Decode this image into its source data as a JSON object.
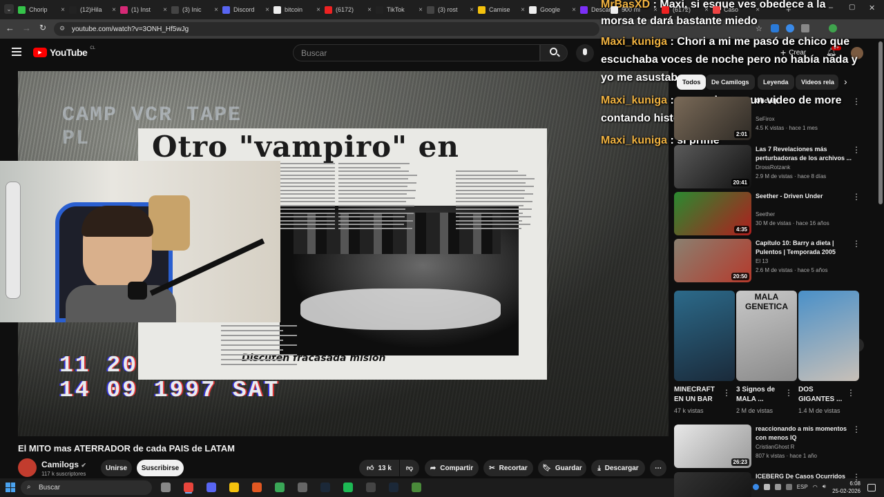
{
  "tabs": [
    {
      "label": "Chorip",
      "color": "#35c44a"
    },
    {
      "label": "(12)Hila",
      "color": "#222"
    },
    {
      "label": "(1) Inst",
      "color": "#d62976"
    },
    {
      "label": "(3) Inic",
      "color": "#444"
    },
    {
      "label": "Discord",
      "color": "#5865f2"
    },
    {
      "label": "bitcoin",
      "color": "#eee"
    },
    {
      "label": "(6172)",
      "color": "#e22"
    },
    {
      "label": "TikTok",
      "color": "#222"
    },
    {
      "label": "(3) rost",
      "color": "#444"
    },
    {
      "label": "Camise",
      "color": "#f4c20d"
    },
    {
      "label": "Google",
      "color": "#eee"
    },
    {
      "label": "Descar",
      "color": "#7b2ff7"
    },
    {
      "label": "500 mi",
      "color": "#eee"
    },
    {
      "label": "(6172)",
      "color": "#e22"
    },
    {
      "label": "Caso",
      "color": "#e44"
    }
  ],
  "address": {
    "url": "youtube.com/watch?v=3ONH_Hf5wJg"
  },
  "yt": {
    "logo": "YouTube",
    "region": "CL",
    "search_placeholder": "Buscar",
    "create": "Crear",
    "notif_badge": "9+"
  },
  "video": {
    "vcr_top": "CAMP  VCR TAPE",
    "vcr_top2": "PL          IPHONE",
    "vcr_time": "11 20",
    "vcr_date": "14 09 1997 SAT",
    "headline": "Otro \"vampiro\" en Ceiba",
    "caption": "Discuten fracasada misión"
  },
  "chat": [
    {
      "user": "MrBasXD",
      "text": "Maxi, si esque ves obedece a la"
    },
    {
      "user": "",
      "text": "morsa te dará bastante miedo"
    },
    {
      "user": "Maxi_kuniga",
      "text": "Chori a mi me pasó de chico que"
    },
    {
      "user": "",
      "text": "escuchaba voces de noche pero no había nada y"
    },
    {
      "user": "",
      "text": "yo me asustaba"
    },
    {
      "user": "Maxi_kuniga",
      "text": "y yo salgo en un video de more"
    },
    {
      "user": "",
      "text": "contando historia de terror"
    },
    {
      "user": "Maxi_kuniga",
      "text": "si prime"
    }
  ],
  "title": "El MITO mas ATERRADOR de cada PAIS de LATAM",
  "channel": {
    "name": "Camilogs",
    "subs": "117 k suscriptores",
    "join": "Unirse",
    "subscribe": "Suscribirse"
  },
  "actions": {
    "likes": "13 k",
    "share": "Compartir",
    "clip": "Recortar",
    "save": "Guardar",
    "download": "Descargar"
  },
  "chips": [
    "Todos",
    "De Camilogs",
    "Leyenda",
    "Videos rela"
  ],
  "recs": [
    {
      "title": "Oficial)",
      "channel": "SeFirox",
      "meta": "4.5 K vistas · hace 1 mes",
      "dur": "2:01",
      "colors": [
        "#7a6a58",
        "#2e2a25"
      ]
    },
    {
      "title": "Las 7 Revelaciones más perturbadoras de los archivos ...",
      "channel": "DrossRotzank",
      "meta": "2.9 M de vistas · hace 8 días",
      "dur": "20:41",
      "colors": [
        "#5a5a5a",
        "#111"
      ]
    },
    {
      "title": "Seether - Driven Under",
      "channel": "Seether",
      "meta": "30 M de vistas · hace 16 años",
      "dur": "4:35",
      "colors": [
        "#2a8a30",
        "#b01e1e"
      ]
    },
    {
      "title": "Capítulo 10: Barry a dieta | Pulentos | Temporada 2005",
      "channel": "El 13",
      "meta": "2.6 M de vistas · hace 5 años",
      "dur": "20:50",
      "colors": [
        "#8a8070",
        "#b53a2c"
      ]
    },
    {
      "title": "reaccionando a mis momentos con menos IQ",
      "channel": "CristianGhost R",
      "meta": "807 k vistas · hace 1 año",
      "dur": "26:23",
      "colors": [
        "#e8e8e8",
        "#9a9a9a"
      ]
    },
    {
      "title": "ICEBERG De Casos Ocurridos",
      "channel": "",
      "meta": "",
      "dur": "",
      "colors": [
        "#333",
        "#111"
      ]
    }
  ],
  "shorts": [
    {
      "title": "MINECRAFT EN UN BAR",
      "views": "47 k vistas",
      "colors": [
        "#2c6a8a",
        "#1a2a3a"
      ]
    },
    {
      "title": "3 Signos de MALA ...",
      "views": "2 M de vistas",
      "overlay": "MALA GENETICA",
      "colors": [
        "#c8c8c8",
        "#8a8a8a"
      ]
    },
    {
      "title": "DOS GIGANTES ...",
      "views": "1.4 M de vistas",
      "colors": [
        "#4a90c8",
        "#c8c0b8"
      ]
    }
  ],
  "taskbar": {
    "search": "Buscar",
    "lang": "ESP",
    "time": "6:08",
    "date": "25-02-2026"
  }
}
